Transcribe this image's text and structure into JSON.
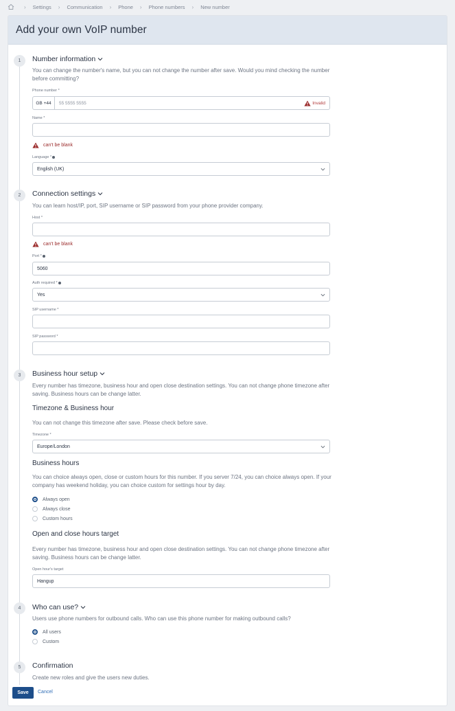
{
  "breadcrumb": {
    "items": [
      "Settings",
      "Communication",
      "Phone",
      "Phone numbers",
      "New number"
    ]
  },
  "page": {
    "title": "Add your own VoIP number"
  },
  "steps": {
    "s1": {
      "num": "1",
      "title": "Number information",
      "desc": "You can change the number's name, but you can not change the number after save. Would you mind checking the number before committing?",
      "phone_label": "Phone number *",
      "country_code": "GB +44",
      "phone_placeholder": "55 5555 5555",
      "invalid": "Invalid",
      "name_label": "Name *",
      "name_value": "",
      "name_error": "can't be blank",
      "language_label": "Language *",
      "language_value": "English (UK)"
    },
    "s2": {
      "num": "2",
      "title": "Connection settings",
      "desc": "You can learn host/IP, port, SIP username or SIP password from your phone provider company.",
      "host_label": "Host *",
      "host_value": "",
      "host_error": "can't be blank",
      "port_label": "Port *",
      "port_value": "5060",
      "auth_label": "Auth required *",
      "auth_value": "Yes",
      "sip_user_label": "SIP username *",
      "sip_user_value": "",
      "sip_pass_label": "SIP password *",
      "sip_pass_value": ""
    },
    "s3": {
      "num": "3",
      "title": "Business hour setup",
      "desc": "Every number has timezone, business hour and open close destination settings. You can not change phone timezone after saving. Business hours can be change latter.",
      "tz_title": "Timezone & Business hour",
      "tz_desc": "You can not change this timezone after save. Please check before save.",
      "tz_label": "Timezone *",
      "tz_value": "Europe/London",
      "bh_title": "Business hours",
      "bh_desc": "You can choice always open, close or custom hours for this number. If you server 7/24, you can choice always open. If your company has weekend holiday, you can choice custom for settings hour by day.",
      "options": [
        "Always open",
        "Always close",
        "Custom hours"
      ],
      "selected": "Always open",
      "oc_title": "Open and close hours target",
      "oc_desc": "Every number has timezone, business hour and open close destination settings. You can not change phone timezone after saving. Business hours can be change latter.",
      "oh_label": "Open hour's target",
      "oh_value": "Hangup"
    },
    "s4": {
      "num": "4",
      "title": "Who can use?",
      "desc": "Users use phone numbers for outbound calls. Who can use this phone number for making outbound calls?",
      "options": [
        "All users",
        "Custom"
      ],
      "selected": "All users"
    },
    "s5": {
      "num": "5",
      "title": "Confirmation",
      "desc": "Create new roles and give the users new duties."
    }
  },
  "actions": {
    "save": "Save",
    "cancel": "Cancel"
  },
  "colors": {
    "primary": "#1d4e8a",
    "error": "#9b2b2b",
    "header_bg": "#dfe6ef"
  }
}
